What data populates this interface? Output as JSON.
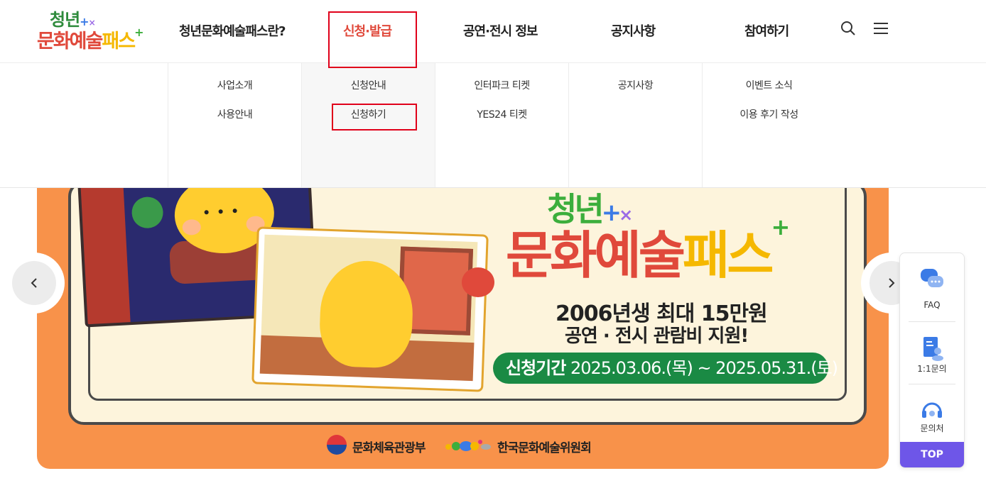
{
  "logo": {
    "line1": "청년",
    "line2_a": "문화예술",
    "line2_b": "패스",
    "plus": "+",
    "cross": "×"
  },
  "gnb": [
    {
      "label": "청년문화예술패스란?"
    },
    {
      "label": "신청·발급"
    },
    {
      "label": "공연·전시 정보"
    },
    {
      "label": "공지사항"
    },
    {
      "label": "참여하기"
    }
  ],
  "icons": {
    "search": "search-icon",
    "menu": "hamburger-menu-icon"
  },
  "submenu": {
    "col1": [
      "사업소개",
      "사용안내"
    ],
    "col2": [
      "신청안내",
      "신청하기"
    ],
    "col3": [
      "인터파크 티켓",
      "YES24 티켓"
    ],
    "col4": [
      "공지사항"
    ],
    "col5": [
      "이벤트 소식",
      "이용 후기 작성"
    ]
  },
  "banner": {
    "title_line1": "청년",
    "title_line2_a": "문화예술",
    "title_line2_b": "패스",
    "sub1": "2006년생 최대 15만원",
    "sub2": "공연 · 전시 관람비 지원!",
    "period_label": "신청기간",
    "period_value": "2025.03.06.(목) ~ 2025.05.31.(토)",
    "sponsor1": "문화체육관광부",
    "sponsor2": "한국문화예술위원회"
  },
  "arrows": {
    "prev": "‹",
    "next": "›"
  },
  "quick_menu": {
    "faq": "FAQ",
    "inquiry": "1:1문의",
    "contact": "문의처",
    "top": "TOP"
  },
  "colors": {
    "accent_red": "#e0493b",
    "top_button": "#6e56e8",
    "banner_orange": "#f8924a",
    "period_green": "#1a8a44",
    "annotation": "#e0001a"
  }
}
